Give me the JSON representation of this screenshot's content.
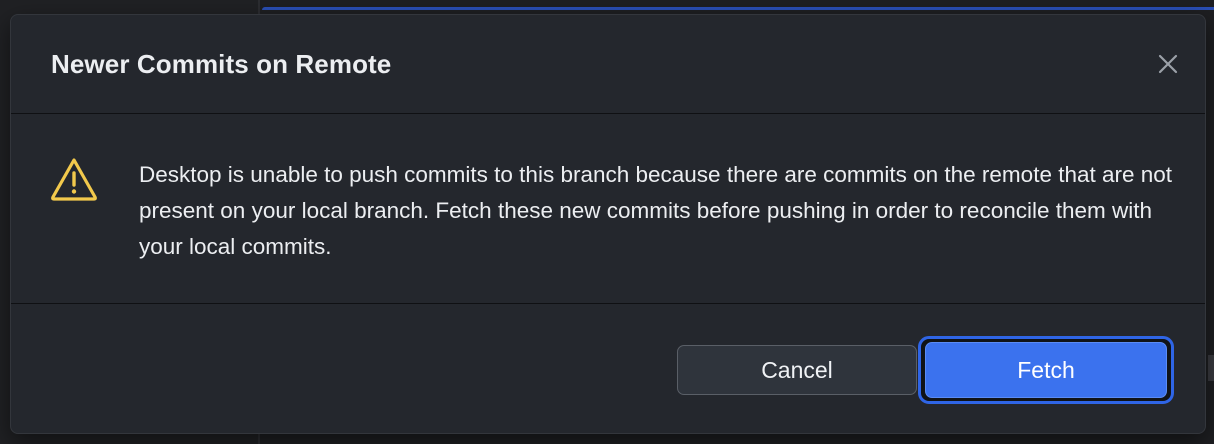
{
  "dialog": {
    "title": "Newer Commits on Remote",
    "close_icon": "close-icon",
    "message": "Desktop is unable to push commits to this branch because there are commits on the remote that are not present on your local branch. Fetch these new commits before pushing in order to reconcile them with your local commits.",
    "message_icon": "warning-icon",
    "buttons": {
      "cancel_label": "Cancel",
      "fetch_label": "Fetch"
    }
  },
  "colors": {
    "dialog_background": "#24272d",
    "primary_button": "#3b72ee",
    "warning": "#f2c94c"
  }
}
